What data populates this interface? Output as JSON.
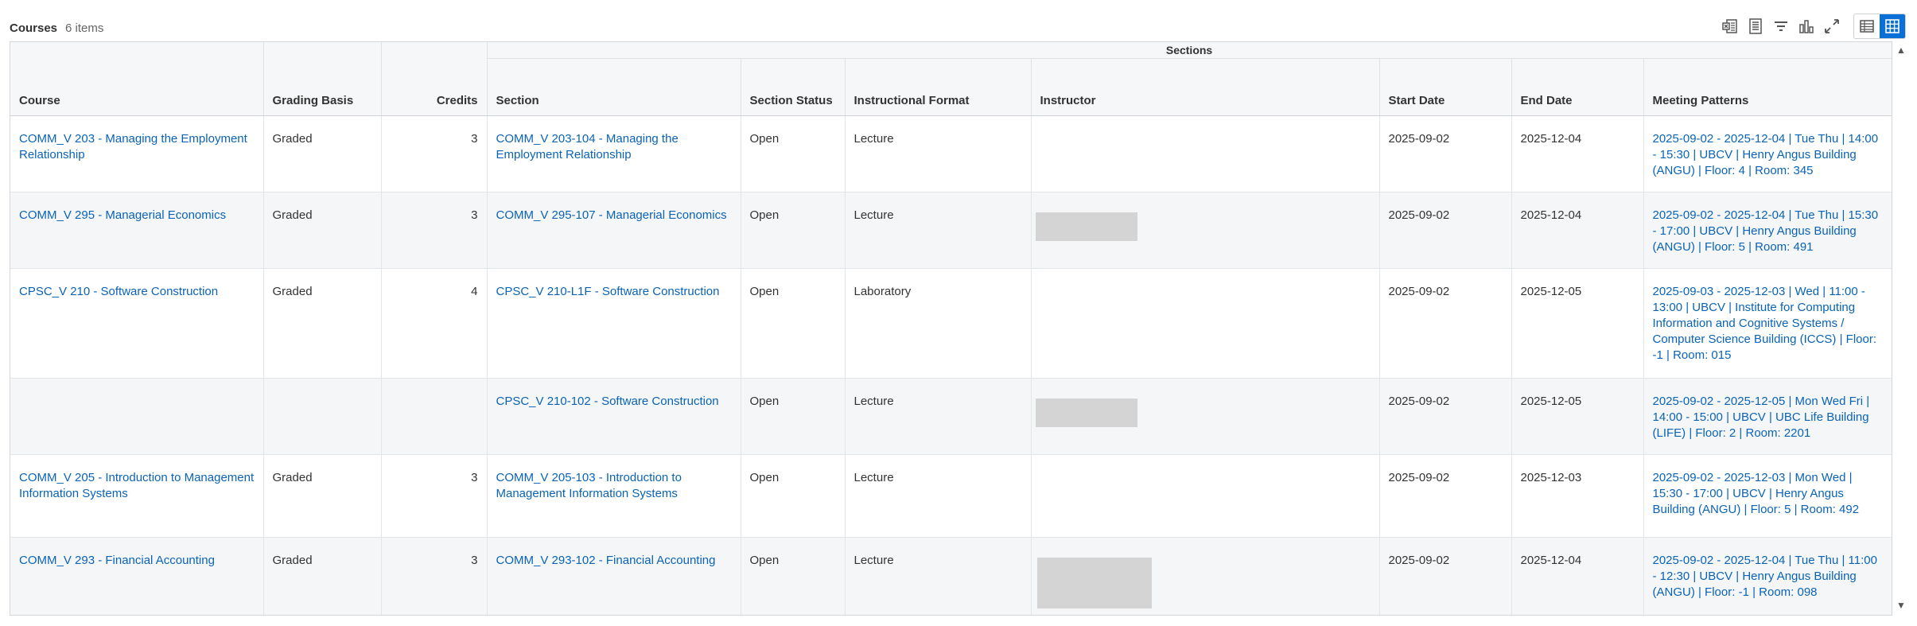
{
  "header": {
    "title": "Courses",
    "count": "6 items"
  },
  "toolbar": {
    "icons": [
      "export-excel-icon",
      "print-icon",
      "filter-icon",
      "chart-icon",
      "fullscreen-icon"
    ],
    "views": [
      "table-view-icon",
      "grid-view-icon"
    ],
    "active_color": "#0a6fd6"
  },
  "table": {
    "group_header": "Sections",
    "columns": {
      "course": "Course",
      "grading": "Grading Basis",
      "credits": "Credits",
      "section": "Section",
      "status": "Section Status",
      "format": "Instructional Format",
      "instructor": "Instructor",
      "start": "Start Date",
      "end": "End Date",
      "meeting": "Meeting Patterns"
    },
    "rows": [
      {
        "course": "COMM_V 203 - Managing the Employment Relationship",
        "grading": "Graded",
        "credits": "3",
        "section": "COMM_V 203-104 - Managing the Employment Relationship",
        "status": "Open",
        "format": "Lecture",
        "start": "2025-09-02",
        "end": "2025-12-04",
        "meeting": "2025-09-02 - 2025-12-04 | Tue Thu | 14:00 - 15:30 | UBCV | Henry Angus Building (ANGU) | Floor: 4 | Room: 345"
      },
      {
        "course": "COMM_V 295 - Managerial Economics",
        "grading": "Graded",
        "credits": "3",
        "section": "COMM_V 295-107 - Managerial Economics",
        "status": "Open",
        "format": "Lecture",
        "start": "2025-09-02",
        "end": "2025-12-04",
        "meeting": "2025-09-02 - 2025-12-04 | Tue Thu | 15:30 - 17:00 | UBCV | Henry Angus Building (ANGU) | Floor: 5 | Room: 491"
      },
      {
        "course": "CPSC_V 210 - Software Construction",
        "grading": "Graded",
        "credits": "4",
        "section": "CPSC_V 210-L1F - Software Construction",
        "status": "Open",
        "format": "Laboratory",
        "start": "2025-09-02",
        "end": "2025-12-05",
        "meeting": "2025-09-03 - 2025-12-03 | Wed | 11:00 - 13:00 | UBCV | Institute for Computing Information and Cognitive Systems / Computer Science Building (ICCS) | Floor: -1 | Room: 015"
      },
      {
        "course": "",
        "grading": "",
        "credits": "",
        "section": "CPSC_V 210-102 - Software Construction",
        "status": "Open",
        "format": "Lecture",
        "start": "2025-09-02",
        "end": "2025-12-05",
        "meeting": "2025-09-02 - 2025-12-05 | Mon Wed Fri | 14:00 - 15:00 | UBCV | UBC Life Building (LIFE) | Floor: 2 | Room: 2201"
      },
      {
        "course": "COMM_V 205 - Introduction to Management Information Systems",
        "grading": "Graded",
        "credits": "3",
        "section": "COMM_V 205-103 - Introduction to Management Information Systems",
        "status": "Open",
        "format": "Lecture",
        "start": "2025-09-02",
        "end": "2025-12-03",
        "meeting": "2025-09-02 - 2025-12-03 | Mon Wed | 15:30 - 17:00 | UBCV | Henry Angus Building (ANGU) | Floor: 5 | Room: 492"
      },
      {
        "course": "COMM_V 293 - Financial Accounting",
        "grading": "Graded",
        "credits": "3",
        "section": "COMM_V 293-102 - Financial Accounting",
        "status": "Open",
        "format": "Lecture",
        "start": "2025-09-02",
        "end": "2025-12-04",
        "meeting": "2025-09-02 - 2025-12-04 | Tue Thu | 11:00 - 12:30 | UBCV | Henry Angus Building (ANGU) | Floor: -1 | Room: 098"
      }
    ]
  },
  "scroll": {
    "up": "▲",
    "down": "▼"
  }
}
